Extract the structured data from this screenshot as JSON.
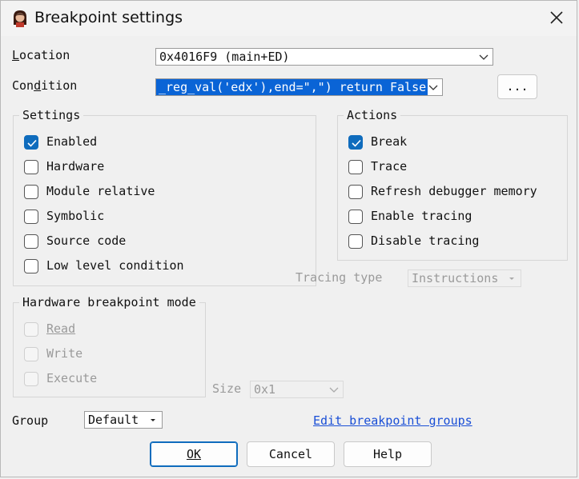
{
  "window": {
    "title": "Breakpoint settings"
  },
  "location": {
    "label": "Location",
    "value": "0x4016F9 (main+ED)"
  },
  "condition": {
    "label": "Condition",
    "value": "_reg_val('edx'),end=\",\") return False",
    "browse_label": "..."
  },
  "settings": {
    "title": "Settings",
    "items": [
      {
        "label": "Enabled",
        "checked": true
      },
      {
        "label": "Hardware",
        "checked": false
      },
      {
        "label": "Module relative",
        "checked": false
      },
      {
        "label": "Symbolic",
        "checked": false
      },
      {
        "label": "Source code",
        "checked": false
      },
      {
        "label": "Low level condition",
        "checked": false
      }
    ]
  },
  "actions": {
    "title": "Actions",
    "items": [
      {
        "label": "Break",
        "checked": true
      },
      {
        "label": "Trace",
        "checked": false
      },
      {
        "label": "Refresh debugger memory",
        "checked": false
      },
      {
        "label": "Enable tracing",
        "checked": false
      },
      {
        "label": "Disable tracing",
        "checked": false
      }
    ]
  },
  "tracing": {
    "label": "Tracing type",
    "value": "Instructions"
  },
  "hw_mode": {
    "title": "Hardware breakpoint mode",
    "items": [
      {
        "label": "Read",
        "checked": false
      },
      {
        "label": "Write",
        "checked": false
      },
      {
        "label": "Execute",
        "checked": false
      }
    ]
  },
  "size": {
    "label": "Size",
    "value": "0x1"
  },
  "group": {
    "label": "Group",
    "value": "Default",
    "edit_link": "Edit breakpoint groups"
  },
  "buttons": {
    "ok": "OK",
    "cancel": "Cancel",
    "help": "Help"
  },
  "colors": {
    "accent": "#0f6cbd",
    "selection": "#0a64d6",
    "link": "#1a4fd6"
  }
}
